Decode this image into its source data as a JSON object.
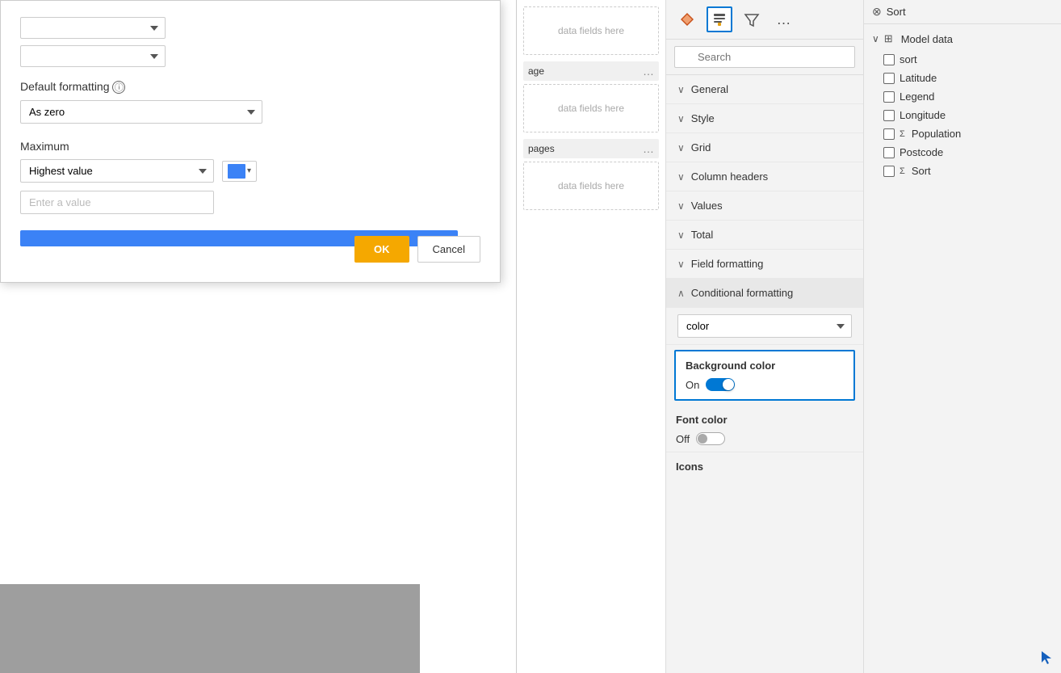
{
  "dialog": {
    "top_dropdown1": {
      "value": "",
      "label": ""
    },
    "top_dropdown2": {
      "value": "",
      "label": ""
    },
    "default_formatting_label": "Default formatting",
    "default_formatting_info": "ⓘ",
    "default_formatting_value": "As zero",
    "maximum_label": "Maximum",
    "maximum_value": "Highest value",
    "maximum_color": "#3b82f6",
    "value_placeholder": "Enter a value",
    "ok_button": "OK",
    "cancel_button": "Cancel"
  },
  "mid_panel": {
    "fields": [
      {
        "text": "data fields here",
        "type": "drop"
      },
      {
        "text": "age",
        "dots": "..."
      },
      {
        "text": "data fields here",
        "type": "drop"
      },
      {
        "text": "pages",
        "dots": "..."
      },
      {
        "text": "data fields here",
        "type": "drop"
      }
    ]
  },
  "format_panel": {
    "icons": [
      {
        "name": "chart-icon",
        "symbol": "📊"
      },
      {
        "name": "format-icon",
        "symbol": "🔧",
        "active": true
      },
      {
        "name": "filter-icon",
        "symbol": "🔍"
      }
    ],
    "search_placeholder": "Search",
    "sections": [
      {
        "label": "General",
        "expanded": false,
        "chevron": "∨"
      },
      {
        "label": "Style",
        "expanded": false,
        "chevron": "∨"
      },
      {
        "label": "Grid",
        "expanded": false,
        "chevron": "∨"
      },
      {
        "label": "Column headers",
        "expanded": false,
        "chevron": "∨"
      },
      {
        "label": "Values",
        "expanded": false,
        "chevron": "∨"
      },
      {
        "label": "Total",
        "expanded": false,
        "chevron": "∨"
      },
      {
        "label": "Field formatting",
        "expanded": false,
        "chevron": "∨"
      },
      {
        "label": "Conditional formatting",
        "expanded": true,
        "chevron": "∧"
      }
    ],
    "dropdown_value": "color",
    "bg_color_title": "Background color",
    "bg_toggle_label": "On",
    "bg_toggle_on": true,
    "font_color_title": "Font color",
    "font_toggle_label": "Off",
    "font_toggle_on": false,
    "icons_title": "Icons"
  },
  "data_panel": {
    "sort_label": "OX Sort",
    "model_data_label": "Model data",
    "fields": [
      {
        "name": "sort",
        "has_checkbox": true,
        "has_sigma": false,
        "checked": false
      },
      {
        "name": "Latitude",
        "has_checkbox": true,
        "has_sigma": false,
        "checked": false
      },
      {
        "name": "Legend",
        "has_checkbox": true,
        "has_sigma": false,
        "checked": false
      },
      {
        "name": "Longitude",
        "has_checkbox": true,
        "has_sigma": false,
        "checked": false
      },
      {
        "name": "Population",
        "has_checkbox": true,
        "has_sigma": true,
        "checked": false
      },
      {
        "name": "Postcode",
        "has_checkbox": true,
        "has_sigma": false,
        "checked": false
      },
      {
        "name": "Sort",
        "has_checkbox": true,
        "has_sigma": true,
        "checked": false
      }
    ]
  }
}
